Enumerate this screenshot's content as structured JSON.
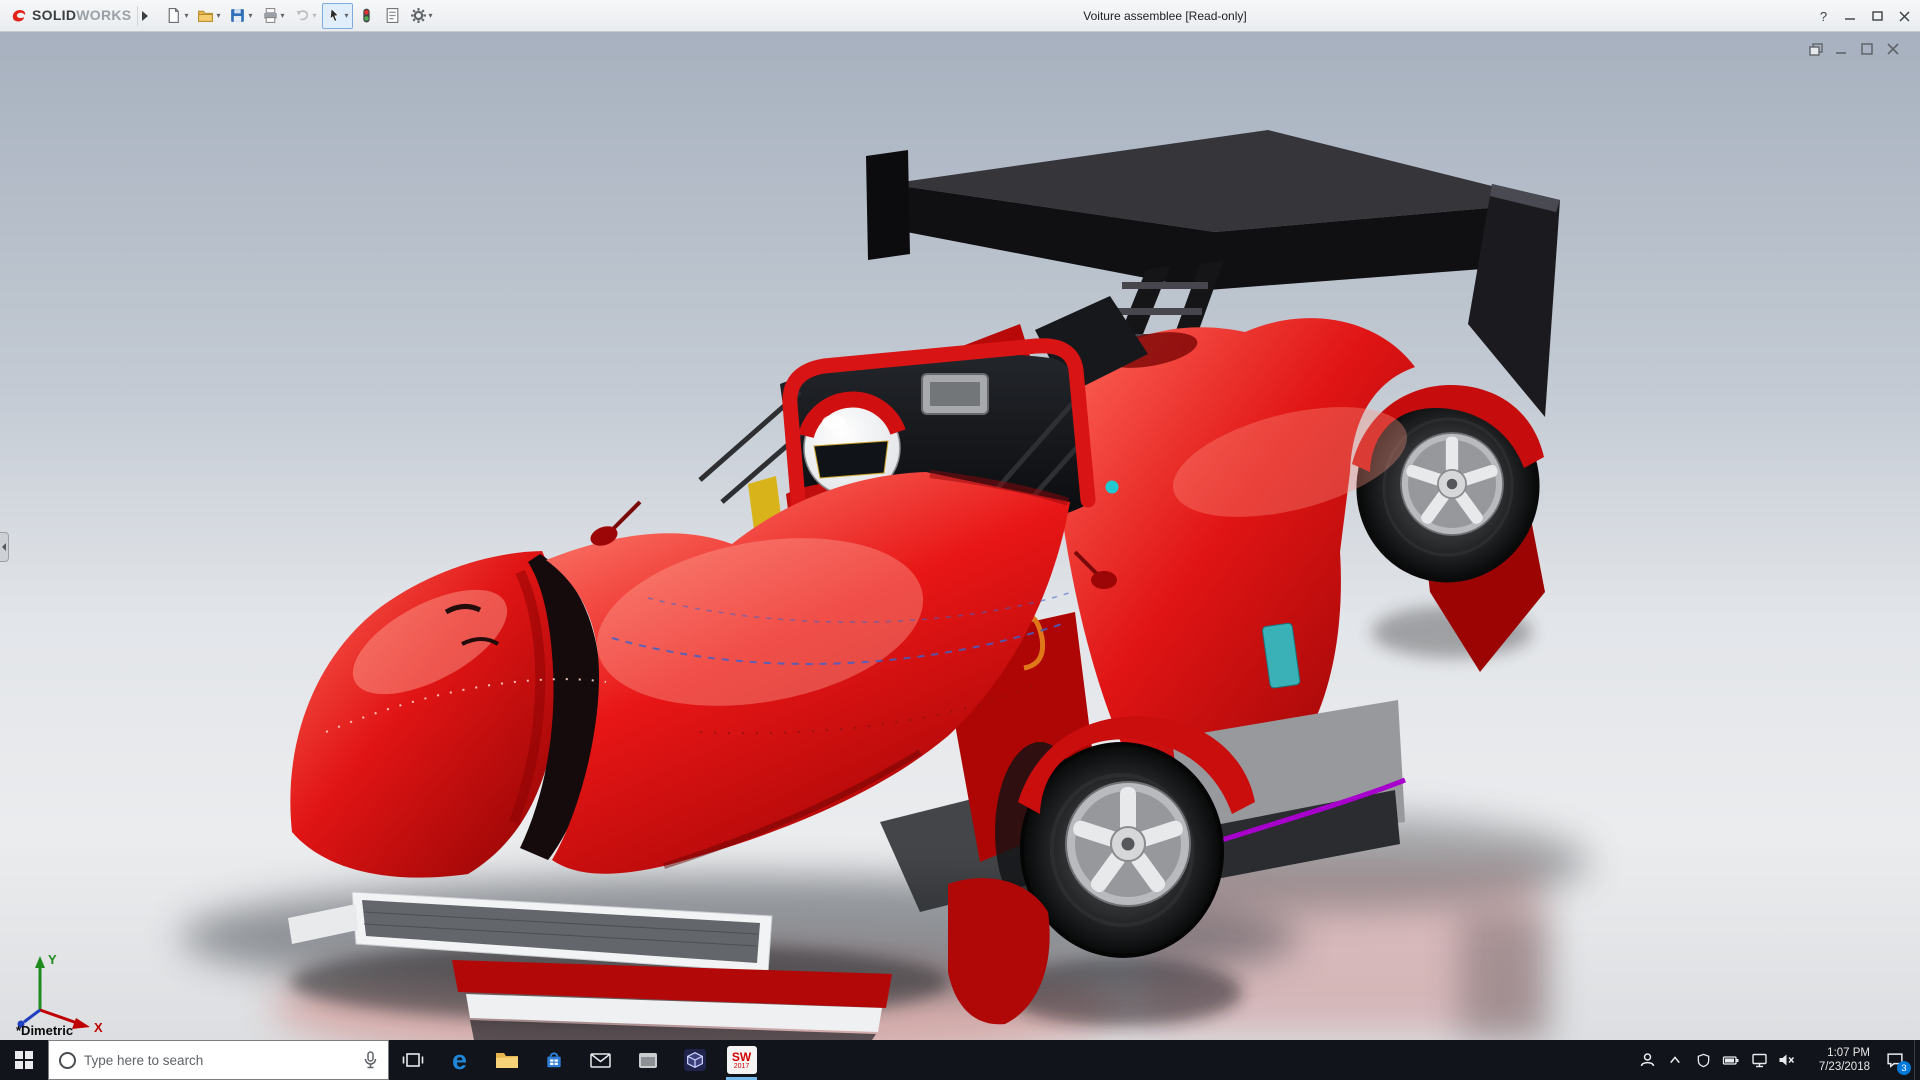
{
  "title_bar": {
    "brand": {
      "prefix": "SOLID",
      "suffix": "WORKS"
    },
    "document_title": "Voiture assemblee [Read-only]",
    "buttons": [
      {
        "id": "new",
        "label": "New",
        "dropdown": true
      },
      {
        "id": "open",
        "label": "Open",
        "dropdown": true
      },
      {
        "id": "save",
        "label": "Save",
        "dropdown": true
      },
      {
        "id": "print",
        "label": "Print",
        "dropdown": true
      },
      {
        "id": "undo",
        "label": "Undo",
        "dropdown": true,
        "disabled": true
      },
      {
        "id": "select",
        "label": "Select",
        "dropdown": true,
        "active": true
      },
      {
        "id": "rebuild",
        "label": "Rebuild"
      },
      {
        "id": "file-properties",
        "label": "File Properties"
      },
      {
        "id": "options",
        "label": "Options",
        "dropdown": true
      }
    ],
    "window_controls": {
      "help_glyph": "?",
      "help": "Help",
      "minimize": "Minimize",
      "maximize": "Maximize",
      "close": "Close"
    }
  },
  "viewport": {
    "view_label": "*Dimetric",
    "triad": {
      "x_label": "X",
      "y_label": "Y"
    },
    "doc_controls": {
      "restore": "Restore Window",
      "minimize": "Minimize Window",
      "maximize": "Maximize Window",
      "close": "Close Window"
    }
  },
  "taskbar": {
    "search": {
      "placeholder": "Type here to search"
    },
    "apps": [
      {
        "id": "task-view",
        "label": "Task View"
      },
      {
        "id": "edge",
        "label": "Microsoft Edge"
      },
      {
        "id": "file-explorer",
        "label": "File Explorer"
      },
      {
        "id": "store",
        "label": "Store"
      },
      {
        "id": "mail",
        "label": "Mail"
      },
      {
        "id": "app-window",
        "label": "App"
      },
      {
        "id": "app-cube",
        "label": "App"
      },
      {
        "id": "solidworks",
        "label": "SOLIDWORKS 2017"
      }
    ],
    "solidworks_badge": {
      "line1": "SW",
      "line2": "2017"
    },
    "tray": {
      "time": "1:07 PM",
      "date": "7/23/2018",
      "notification_count": "3"
    }
  },
  "colors": {
    "accent_red": "#d40000",
    "body_highlight": "#ff8a7a",
    "wing_black": "#131316",
    "titlebar_bg": "#e9ecef",
    "taskbar_bg": "#11141b",
    "search_bg": "#ffffff",
    "underline_running": "#76b9ed",
    "sky_top": "#a7b1bf",
    "sky_bottom": "#dcdee1",
    "teal_accent": "#2fbfc6",
    "purple_accent": "#a800cc",
    "harness_yellow": "#e2bd1c",
    "grille_gray": "#63666a"
  }
}
